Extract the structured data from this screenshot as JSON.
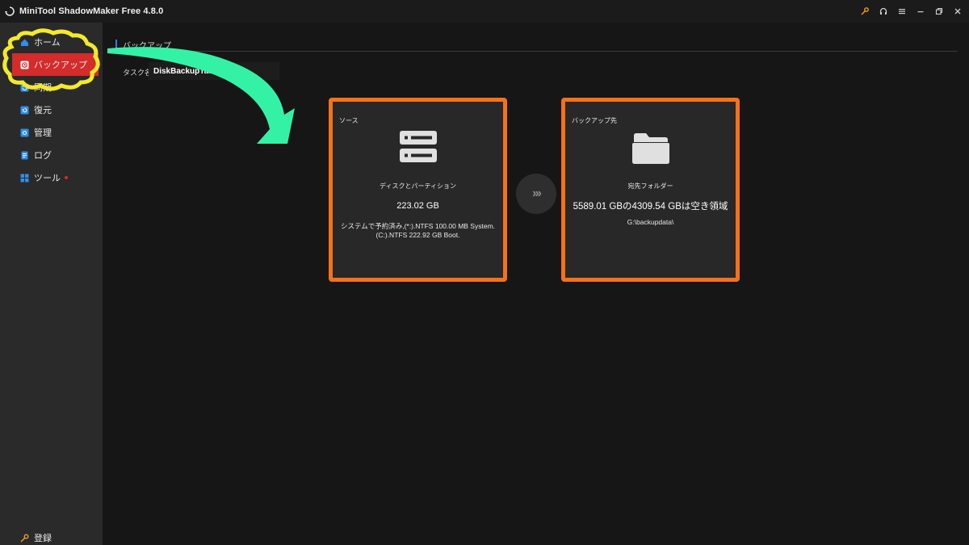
{
  "app": {
    "title": "MiniTool ShadowMaker Free 4.8.0"
  },
  "title_controls": [
    "key-icon",
    "headset-icon",
    "menu-icon",
    "minimize-icon",
    "restore-icon",
    "close-icon"
  ],
  "sidebar": {
    "items": [
      {
        "label": "ホーム",
        "icon": "home-icon"
      },
      {
        "label": "バックアップ",
        "icon": "backup-icon"
      },
      {
        "label": "同期",
        "icon": "sync-icon"
      },
      {
        "label": "復元",
        "icon": "restore-icon"
      },
      {
        "label": "管理",
        "icon": "manage-icon"
      },
      {
        "label": "ログ",
        "icon": "log-icon"
      },
      {
        "label": "ツール",
        "icon": "tools-icon"
      }
    ],
    "register_label": "登録"
  },
  "main": {
    "section_title": "バックアップ",
    "task_name_label": "タスク名:",
    "task_name_value": "DiskBackupTask"
  },
  "source_card": {
    "label": "ソース",
    "icon": "disk-icon",
    "subtitle": "ディスクとパーティション",
    "size": "223.02 GB",
    "detail": "システムで予約済み,(*:).NTFS 100.00 MB System. (C:).NTFS 222.92 GB Boot."
  },
  "dest_card": {
    "label": "バックアップ先",
    "icon": "folder-icon",
    "subtitle": "宛先フォルダー",
    "space": "5589.01 GBの4309.54 GBは空き領域",
    "path": "G:\\backupdata\\"
  },
  "colors": {
    "accent_orange": "#f57218",
    "active_red": "#d42b2b",
    "annotation_green": "#33f2a6",
    "annotation_yellow": "#f2ea2a"
  }
}
